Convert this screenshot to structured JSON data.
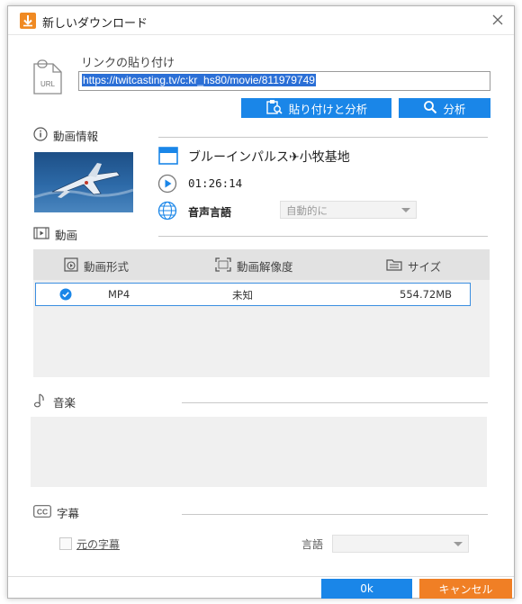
{
  "window": {
    "title": "新しいダウンロード"
  },
  "link": {
    "label": "リンクの貼り付け",
    "url_value": "https://twitcasting.tv/c:kr_hs80/movie/811979749",
    "paste_analyze_label": "貼り付けと分析",
    "analyze_label": "分析"
  },
  "video_info": {
    "section_label": "動画情報",
    "title": "ブルーインパルス✈小牧基地",
    "duration": "01:26:14",
    "audio_language_label": "音声言語",
    "audio_language_value": "自動的に"
  },
  "video": {
    "section_label": "動画",
    "columns": {
      "format": "動画形式",
      "resolution": "動画解像度",
      "size": "サイズ"
    },
    "rows": [
      {
        "format": "MP4",
        "resolution": "未知",
        "size": "554.72MB",
        "selected": true
      }
    ]
  },
  "music": {
    "section_label": "音楽"
  },
  "subtitles": {
    "section_label": "字幕",
    "original_label": "元の字幕",
    "language_label": "言語",
    "language_value": ""
  },
  "footer": {
    "ok_label": "0k",
    "cancel_label": "キャンセル"
  },
  "colors": {
    "accent_blue": "#1a86e8",
    "cancel_orange": "#f07f25",
    "app_icon_orange": "#f08a23"
  }
}
